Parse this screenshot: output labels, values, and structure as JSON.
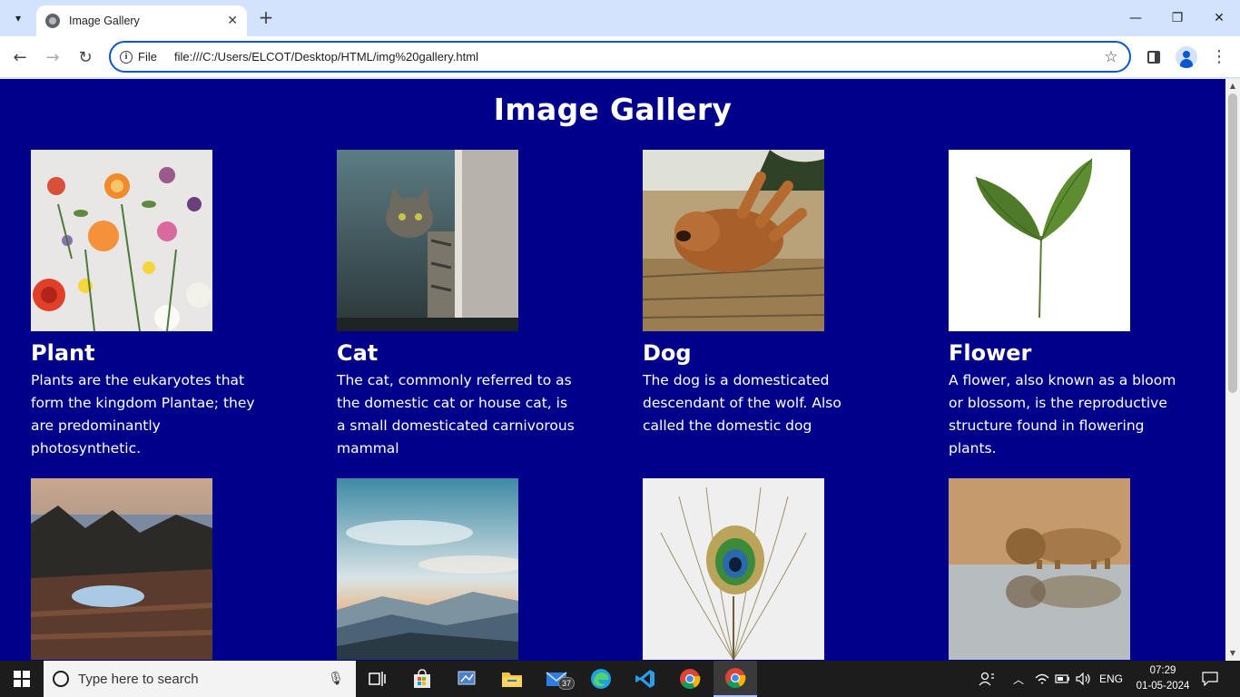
{
  "browser": {
    "tab_title": "Image Gallery",
    "url_scheme": "File",
    "url": "file:///C:/Users/ELCOT/Desktop/HTML/img%20gallery.html"
  },
  "page": {
    "title": "Image Gallery",
    "cards": [
      {
        "name": "Plant",
        "description": "Plants are the eukaryotes that form the kingdom Plantae; they are predominantly photosynthetic.",
        "image": "flowers-flatlay"
      },
      {
        "name": "Cat",
        "description": "The cat, commonly referred to as the domestic cat or house cat, is a small domesticated carnivorous mammal",
        "image": "tabby-cat"
      },
      {
        "name": "Dog",
        "description": "The dog is a domesticated descendant of the wolf. Also called the domestic dog",
        "image": "golden-dog"
      },
      {
        "name": "Flower",
        "description": "A flower, also known as a bloom or blossom, is the reproductive structure found in flowering plants.",
        "image": "green-sprout"
      },
      {
        "name": "",
        "description": "",
        "image": "lake-sunset"
      },
      {
        "name": "",
        "description": "",
        "image": "mountain-sky"
      },
      {
        "name": "",
        "description": "",
        "image": "peacock-feather"
      },
      {
        "name": "",
        "description": "",
        "image": "lion-drinking"
      }
    ]
  },
  "taskbar": {
    "search_placeholder": "Type here to search",
    "mail_badge": "37",
    "language": "ENG",
    "time": "07:29",
    "date": "01-05-2024"
  },
  "colors": {
    "page_background": "#00008b",
    "omnibox_border": "#0b57d0",
    "tabstrip": "#d3e3fd"
  }
}
